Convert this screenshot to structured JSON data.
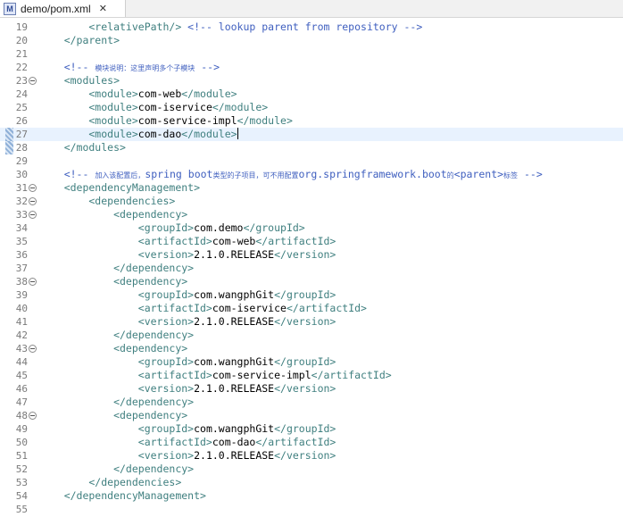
{
  "tab": {
    "title": "demo/pom.xml",
    "close": "✕",
    "icon": "M"
  },
  "lines": [
    {
      "n": "19",
      "parts": [
        [
          "t",
          "        <relativePath/> "
        ],
        [
          "c",
          "<!-- lookup parent from repository -->"
        ]
      ]
    },
    {
      "n": "20",
      "parts": [
        [
          "t",
          "    </parent>"
        ]
      ]
    },
    {
      "n": "21",
      "parts": []
    },
    {
      "n": "22",
      "parts": [
        [
          "c",
          "    <!-- "
        ],
        [
          "cj",
          "模块说明：这里声明多个子模块"
        ],
        [
          "c",
          " -->"
        ]
      ]
    },
    {
      "n": "23",
      "fold": true,
      "parts": [
        [
          "t",
          "    <modules>"
        ]
      ]
    },
    {
      "n": "24",
      "parts": [
        [
          "t",
          "        <module>"
        ],
        [
          "x",
          "com-web"
        ],
        [
          "t",
          "</module>"
        ]
      ]
    },
    {
      "n": "25",
      "parts": [
        [
          "t",
          "        <module>"
        ],
        [
          "x",
          "com-iservice"
        ],
        [
          "t",
          "</module>"
        ]
      ]
    },
    {
      "n": "26",
      "parts": [
        [
          "t",
          "        <module>"
        ],
        [
          "x",
          "com-service-impl"
        ],
        [
          "t",
          "</module>"
        ]
      ]
    },
    {
      "n": "27",
      "current": true,
      "marker": true,
      "parts": [
        [
          "t",
          "        <module>"
        ],
        [
          "x",
          "com-dao"
        ],
        [
          "t",
          "</module>"
        ],
        [
          "cursor",
          ""
        ]
      ]
    },
    {
      "n": "28",
      "marker": true,
      "parts": [
        [
          "t",
          "    </modules>"
        ]
      ]
    },
    {
      "n": "29",
      "parts": []
    },
    {
      "n": "30",
      "parts": [
        [
          "c",
          "    <!-- "
        ],
        [
          "cj",
          "加入该配置后，"
        ],
        [
          "c",
          "spring boot"
        ],
        [
          "cj",
          "类型的子项目，可不用配置"
        ],
        [
          "c",
          "org.springframework.boot"
        ],
        [
          "cj",
          "的"
        ],
        [
          "c",
          "<parent>"
        ],
        [
          "cj",
          "标签"
        ],
        [
          "c",
          " -->"
        ]
      ]
    },
    {
      "n": "31",
      "fold": true,
      "parts": [
        [
          "t",
          "    <dependencyManagement>"
        ]
      ]
    },
    {
      "n": "32",
      "fold": true,
      "parts": [
        [
          "t",
          "        <dependencies>"
        ]
      ]
    },
    {
      "n": "33",
      "fold": true,
      "parts": [
        [
          "t",
          "            <dependency>"
        ]
      ]
    },
    {
      "n": "34",
      "parts": [
        [
          "t",
          "                <groupId>"
        ],
        [
          "x",
          "com.demo"
        ],
        [
          "t",
          "</groupId>"
        ]
      ]
    },
    {
      "n": "35",
      "parts": [
        [
          "t",
          "                <artifactId>"
        ],
        [
          "x",
          "com-web"
        ],
        [
          "t",
          "</artifactId>"
        ]
      ]
    },
    {
      "n": "36",
      "parts": [
        [
          "t",
          "                <version>"
        ],
        [
          "x",
          "2.1.0.RELEASE"
        ],
        [
          "t",
          "</version>"
        ]
      ]
    },
    {
      "n": "37",
      "parts": [
        [
          "t",
          "            </dependency>"
        ]
      ]
    },
    {
      "n": "38",
      "fold": true,
      "parts": [
        [
          "t",
          "            <dependency>"
        ]
      ]
    },
    {
      "n": "39",
      "parts": [
        [
          "t",
          "                <groupId>"
        ],
        [
          "x",
          "com.wangphGit"
        ],
        [
          "t",
          "</groupId>"
        ]
      ]
    },
    {
      "n": "40",
      "parts": [
        [
          "t",
          "                <artifactId>"
        ],
        [
          "x",
          "com-iservice"
        ],
        [
          "t",
          "</artifactId>"
        ]
      ]
    },
    {
      "n": "41",
      "parts": [
        [
          "t",
          "                <version>"
        ],
        [
          "x",
          "2.1.0.RELEASE"
        ],
        [
          "t",
          "</version>"
        ]
      ]
    },
    {
      "n": "42",
      "parts": [
        [
          "t",
          "            </dependency>"
        ]
      ]
    },
    {
      "n": "43",
      "fold": true,
      "parts": [
        [
          "t",
          "            <dependency>"
        ]
      ]
    },
    {
      "n": "44",
      "parts": [
        [
          "t",
          "                <groupId>"
        ],
        [
          "x",
          "com.wangphGit"
        ],
        [
          "t",
          "</groupId>"
        ]
      ]
    },
    {
      "n": "45",
      "parts": [
        [
          "t",
          "                <artifactId>"
        ],
        [
          "x",
          "com-service-impl"
        ],
        [
          "t",
          "</artifactId>"
        ]
      ]
    },
    {
      "n": "46",
      "parts": [
        [
          "t",
          "                <version>"
        ],
        [
          "x",
          "2.1.0.RELEASE"
        ],
        [
          "t",
          "</version>"
        ]
      ]
    },
    {
      "n": "47",
      "parts": [
        [
          "t",
          "            </dependency>"
        ]
      ]
    },
    {
      "n": "48",
      "fold": true,
      "parts": [
        [
          "t",
          "            <dependency>"
        ]
      ]
    },
    {
      "n": "49",
      "parts": [
        [
          "t",
          "                <groupId>"
        ],
        [
          "x",
          "com.wangphGit"
        ],
        [
          "t",
          "</groupId>"
        ]
      ]
    },
    {
      "n": "50",
      "parts": [
        [
          "t",
          "                <artifactId>"
        ],
        [
          "x",
          "com-dao"
        ],
        [
          "t",
          "</artifactId>"
        ]
      ]
    },
    {
      "n": "51",
      "parts": [
        [
          "t",
          "                <version>"
        ],
        [
          "x",
          "2.1.0.RELEASE"
        ],
        [
          "t",
          "</version>"
        ]
      ]
    },
    {
      "n": "52",
      "parts": [
        [
          "t",
          "            </dependency>"
        ]
      ]
    },
    {
      "n": "53",
      "parts": [
        [
          "t",
          "        </dependencies>"
        ]
      ]
    },
    {
      "n": "54",
      "parts": [
        [
          "t",
          "    </dependencyManagement>"
        ]
      ]
    },
    {
      "n": "55",
      "parts": []
    }
  ]
}
